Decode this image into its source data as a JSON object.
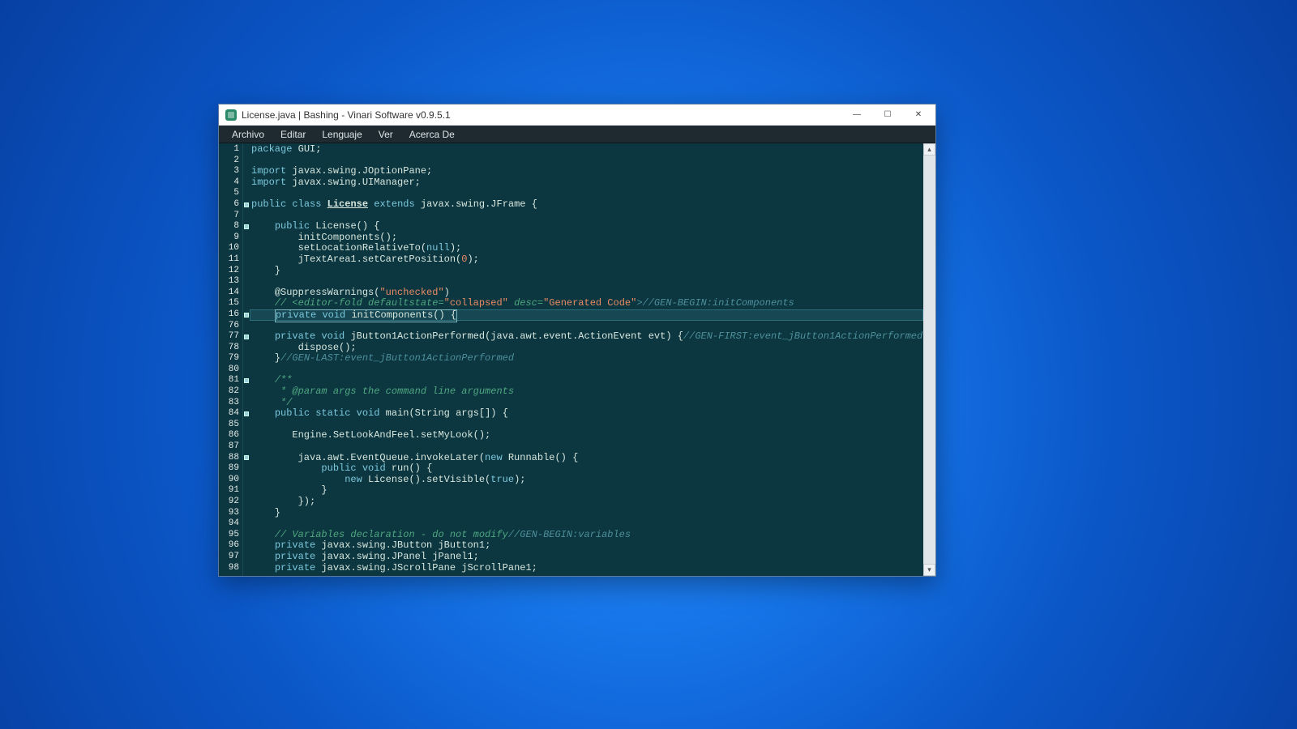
{
  "window": {
    "title": "License.java | Bashing - Vinari Software v0.9.5.1"
  },
  "menubar": {
    "items": [
      "Archivo",
      "Editar",
      "Lenguaje",
      "Ver",
      "Acerca De"
    ]
  },
  "win_controls": {
    "minimize": "—",
    "maximize": "☐",
    "close": "✕"
  },
  "scrollbar": {
    "up": "▴",
    "down": "▾"
  },
  "highlight_line_index": 15,
  "lines": [
    {
      "n": 1,
      "fold": false,
      "html": "<span class='kw'>package</span> GUI;"
    },
    {
      "n": 2,
      "fold": false,
      "html": ""
    },
    {
      "n": 3,
      "fold": false,
      "html": "<span class='kw'>import</span> javax.swing.JOptionPane;"
    },
    {
      "n": 4,
      "fold": false,
      "html": "<span class='kw'>import</span> javax.swing.UIManager;"
    },
    {
      "n": 5,
      "fold": false,
      "html": ""
    },
    {
      "n": 6,
      "fold": true,
      "html": "<span class='kw'>public</span> <span class='kw'>class</span> <span class='cls'>License</span> <span class='kw'>extends</span> javax.swing.JFrame {"
    },
    {
      "n": 7,
      "fold": false,
      "html": ""
    },
    {
      "n": 8,
      "fold": true,
      "html": "    <span class='kw'>public</span> License() {"
    },
    {
      "n": 9,
      "fold": false,
      "html": "        initComponents();"
    },
    {
      "n": 10,
      "fold": false,
      "html": "        setLocationRelativeTo(<span class='kw'>null</span>);"
    },
    {
      "n": 11,
      "fold": false,
      "html": "        jTextArea1.setCaretPosition(<span class='num'>0</span>);"
    },
    {
      "n": 12,
      "fold": false,
      "html": "    }"
    },
    {
      "n": 13,
      "fold": false,
      "html": ""
    },
    {
      "n": 14,
      "fold": false,
      "html": "    <span class='ann'>@SuppressWarnings</span>(<span class='str'>\"unchecked\"</span>)"
    },
    {
      "n": 15,
      "fold": false,
      "html": "    <span class='cmitalic'>// &lt;editor-fold defaultstate=</span><span class='str'>\"collapsed\"</span> <span class='cmitalic'>desc=</span><span class='str'>\"Generated Code\"</span><span class='cmgray'>&gt;//GEN-BEGIN:initComponents</span>"
    },
    {
      "n": 16,
      "fold": true,
      "html": "    <span class='box'><span class='kw'>private</span> <span class='kw'>void</span> initComponents() {</span>"
    },
    {
      "n": 76,
      "fold": false,
      "html": ""
    },
    {
      "n": 77,
      "fold": true,
      "html": "    <span class='kw'>private</span> <span class='kw'>void</span> jButton1ActionPerformed(java.awt.event.ActionEvent evt) {<span class='cmgray'>//GEN-FIRST:event_jButton1ActionPerformed</span>"
    },
    {
      "n": 78,
      "fold": false,
      "html": "        dispose();"
    },
    {
      "n": 79,
      "fold": false,
      "html": "    }<span class='cmgray'>//GEN-LAST:event_jButton1ActionPerformed</span>"
    },
    {
      "n": 80,
      "fold": false,
      "html": ""
    },
    {
      "n": 81,
      "fold": true,
      "html": "    <span class='cmitalic'>/**</span>"
    },
    {
      "n": 82,
      "fold": false,
      "html": "     <span class='cmitalic'>* @param args the command line arguments</span>"
    },
    {
      "n": 83,
      "fold": false,
      "html": "     <span class='cmitalic'>*/</span>"
    },
    {
      "n": 84,
      "fold": true,
      "html": "    <span class='kw'>public</span> <span class='kw'>static</span> <span class='kw'>void</span> main(String args[]) {"
    },
    {
      "n": 85,
      "fold": false,
      "html": ""
    },
    {
      "n": 86,
      "fold": false,
      "html": "       Engine.SetLookAndFeel.setMyLook();"
    },
    {
      "n": 87,
      "fold": false,
      "html": ""
    },
    {
      "n": 88,
      "fold": true,
      "html": "        java.awt.EventQueue.invokeLater(<span class='kw'>new</span> Runnable() {"
    },
    {
      "n": 89,
      "fold": false,
      "html": "            <span class='kw'>public</span> <span class='kw'>void</span> run() {"
    },
    {
      "n": 90,
      "fold": false,
      "html": "                <span class='kw'>new</span> License().setVisible(<span class='kw'>true</span>);"
    },
    {
      "n": 91,
      "fold": false,
      "html": "            }"
    },
    {
      "n": 92,
      "fold": false,
      "html": "        });"
    },
    {
      "n": 93,
      "fold": false,
      "html": "    }"
    },
    {
      "n": 94,
      "fold": false,
      "html": ""
    },
    {
      "n": 95,
      "fold": false,
      "html": "    <span class='cmitalic'>// Variables declaration - do not modify</span><span class='cmgray'>//GEN-BEGIN:variables</span>"
    },
    {
      "n": 96,
      "fold": false,
      "html": "    <span class='kw'>private</span> javax.swing.JButton jButton1;"
    },
    {
      "n": 97,
      "fold": false,
      "html": "    <span class='kw'>private</span> javax.swing.JPanel jPanel1;"
    },
    {
      "n": 98,
      "fold": false,
      "html": "    <span class='kw'>private</span> javax.swing.JScrollPane jScrollPane1;"
    }
  ]
}
